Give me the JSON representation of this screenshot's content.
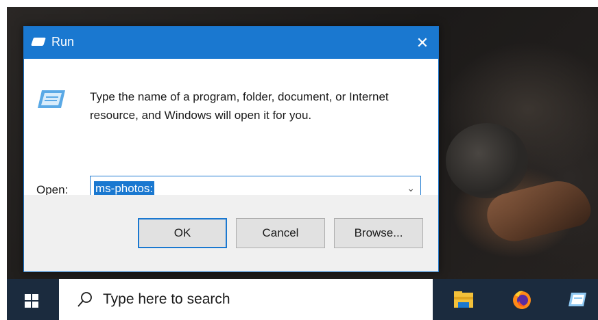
{
  "dialog": {
    "title": "Run",
    "close_glyph": "✕",
    "description": "Type the name of a program, folder, document, or Internet resource, and Windows will open it for you.",
    "open_label": "Open:",
    "open_value": "ms-photos:",
    "dropdown_glyph": "⌄",
    "buttons": {
      "ok": "OK",
      "cancel": "Cancel",
      "browse": "Browse..."
    }
  },
  "taskbar": {
    "search_placeholder": "Type here to search",
    "icons": [
      "windows-start-icon",
      "search-icon",
      "file-explorer-icon",
      "firefox-icon",
      "run-icon"
    ]
  },
  "colors": {
    "accent": "#1a78d0",
    "taskbar": "#1b2b3e",
    "footer": "#f0f0f0"
  }
}
